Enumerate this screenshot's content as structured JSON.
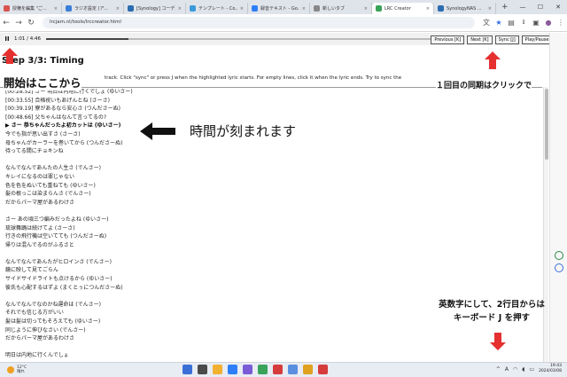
{
  "browser": {
    "tabs": [
      {
        "label": "授権を編集 \"ご...",
        "color": "#d9534f",
        "active": false
      },
      {
        "label": "ラジオ設定 (ア...",
        "color": "#3b7fd9",
        "active": false
      },
      {
        "label": "[Synology] コーデ...",
        "color": "#2b6cb0",
        "active": false
      },
      {
        "label": "テンプレート - Co...",
        "color": "#3a9ad9",
        "active": false
      },
      {
        "label": "録音テキスト - Go...",
        "color": "#2d7ff9",
        "active": false
      },
      {
        "label": "新しいタブ",
        "color": "#888888",
        "active": false
      },
      {
        "label": "LRC Creator",
        "color": "#3aa35a",
        "active": true
      },
      {
        "label": "SynologyNAS ...",
        "color": "#2b6cb0",
        "active": false
      }
    ],
    "new_tab_symbol": "+",
    "url": "lrcjam.nl/tools/lrccreator.html",
    "window_controls": [
      "—",
      "☐",
      "✕"
    ]
  },
  "player": {
    "play_symbol": "II",
    "time": "1:01 / 4:46",
    "progress": 0.213
  },
  "controls": {
    "previous": "Previous [K]",
    "next": "Next [K]",
    "sync": "Sync [J]",
    "play_pause": "Play/Pause [P]"
  },
  "step_title": "Step 3/3: Timing",
  "hint": "track. Click \"sync\" or press J when the highlighted lyric starts. For empty lines, click it when the lyric ends. Try to sync the",
  "annotations": {
    "start_here": "開始はここから",
    "first_sync": "１回目の同期はクリックで",
    "time_engraved": "時間が刻まれます",
    "keyboard_line1": "英数字にして、2行目からは",
    "keyboard_line2": "キーボード J を押す",
    "arrow_color": "#e53030"
  },
  "lyrics": [
    {
      "text": "[00:28.52] さー 明日は内地に行くでしょ (ゆいさー)",
      "current": false
    },
    {
      "text": "[00:33.55] 合格祝いもあげんとね (さーさ)",
      "current": false
    },
    {
      "text": "[00:39.19] 寮があるなら安心さ (つんださーぬ)",
      "current": false
    },
    {
      "text": "[00:48.66] 父ちゃんはなんて言ってるの?",
      "current": false
    },
    {
      "text": "▶ さー 恭ちゃんだったよ初カットは (ゆいさー)",
      "current": true
    },
    {
      "text": "今でも指が思い出すさ (さーさ)",
      "current": false
    },
    {
      "text": "母ちゃんがカーラーを巻いてから (つんださーぬ)",
      "current": false
    },
    {
      "text": "待ってる間にチョキンね",
      "current": false
    },
    {
      "text": "",
      "current": false
    },
    {
      "text": "なんでなんであんたの人生さ (でんさー)",
      "current": false
    },
    {
      "text": "キレイになるのは罪じゃない",
      "current": false
    },
    {
      "text": "色を色をぬいても重ねても (ゆいさー)",
      "current": false
    },
    {
      "text": "髪の根っこは染まらんさ (でんさー)",
      "current": false
    },
    {
      "text": "だからパーマ屋があるわけさ",
      "current": false
    },
    {
      "text": "",
      "current": false
    },
    {
      "text": "さー あの頃三つ編みだったよね (ゆいさー)",
      "current": false
    },
    {
      "text": "琉球舞踊は続けてよ (さーさ)",
      "current": false
    },
    {
      "text": "行きの飛行機は空いてても (つんださーぬ)",
      "current": false
    },
    {
      "text": "帰りは混んでるのがふるさと",
      "current": false
    },
    {
      "text": "",
      "current": false
    },
    {
      "text": "なんでなんであんたがヒロインさ (でんさー)",
      "current": false
    },
    {
      "text": "鏡に映して見てごらん",
      "current": false
    },
    {
      "text": "サイドサイドライトも点けるから (ゆいさー)",
      "current": false
    },
    {
      "text": "彼氏も心配するはずよ (まくとぅにつんださーぬ)",
      "current": false
    },
    {
      "text": "",
      "current": false
    },
    {
      "text": "なんでなんでなのかね運命は (でんさー)",
      "current": false
    },
    {
      "text": "それでも信じる方がいい",
      "current": false
    },
    {
      "text": "髪は髪は切ってもそろえても (ゆいさー)",
      "current": false
    },
    {
      "text": "同じように伸びなさい (でんさー)",
      "current": false
    },
    {
      "text": "だからパーマ屋があるわけさ",
      "current": false
    },
    {
      "text": "",
      "current": false
    },
    {
      "text": "明日は内地に行くんでしょ",
      "current": false
    }
  ],
  "taskbar": {
    "weather_temp": "12°C",
    "weather_cond": "晴れ",
    "apps": [
      "#3b6fd8",
      "#4a4a4a",
      "#f2b030",
      "#2d7ff9",
      "#7a5cd6",
      "#3aa35a",
      "#d63c3c",
      "#5a8fe0",
      "#e0a020",
      "#d63c3c"
    ],
    "tray_a": "A",
    "clock_time": "19:43",
    "clock_date": "2024/03/08"
  }
}
